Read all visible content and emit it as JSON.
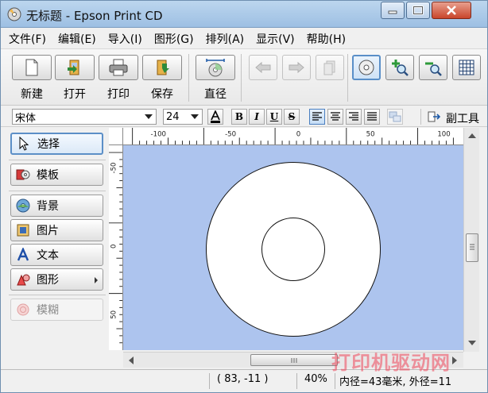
{
  "window": {
    "title": "无标题 - Epson Print CD"
  },
  "menu": [
    "文件(F)",
    "编辑(E)",
    "导入(I)",
    "图形(G)",
    "排列(A)",
    "显示(V)",
    "帮助(H)"
  ],
  "toolbar": {
    "new_label": "新建",
    "open_label": "打开",
    "print_label": "打印",
    "save_label": "保存",
    "diameter_label": "直径"
  },
  "format": {
    "font_name": "宋体",
    "font_size": "24",
    "bold": "B",
    "italic": "I",
    "underline": "U",
    "strike": "S",
    "toolbox_label": "副工具"
  },
  "left_panel": {
    "select": "选择",
    "template": "模板",
    "background": "背景",
    "image": "图片",
    "text": "文本",
    "shape": "图形",
    "blur": "模糊"
  },
  "ruler": {
    "h_ticks": [
      "-100",
      "-50",
      "0",
      "50",
      "100"
    ],
    "v_ticks": [
      "-50",
      "0",
      "50"
    ]
  },
  "status": {
    "coords": "( 83, -11 )",
    "zoom": "40%",
    "diameter_info": "内径=43毫米, 外径=11"
  },
  "watermark": "打印机驱动网",
  "colors": {
    "canvas_bg": "#adc4ee",
    "titlebar": "#a9c8ea",
    "watermark": "#ee465a"
  }
}
